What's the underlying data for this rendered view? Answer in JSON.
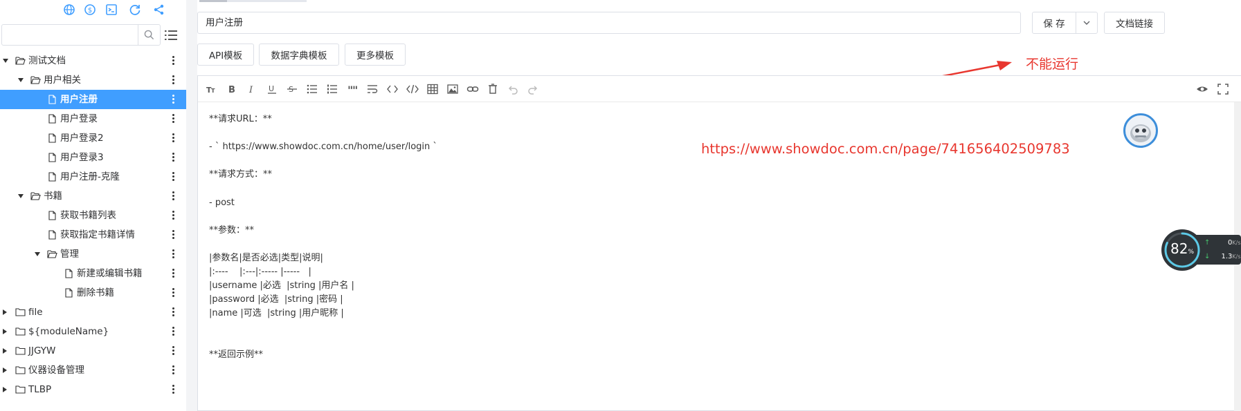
{
  "sidebar": {
    "search": {
      "value": "",
      "placeholder": ""
    },
    "top_icons": [
      "globe-icon",
      "dollar-icon",
      "terminal-icon",
      "refresh-icon",
      "share-icon"
    ],
    "tree": [
      {
        "label": "测试文档",
        "type": "folder",
        "expanded": true,
        "level": 0
      },
      {
        "label": "用户相关",
        "type": "folder",
        "expanded": true,
        "level": 1
      },
      {
        "label": "用户注册",
        "type": "file",
        "level": 2,
        "selected": true
      },
      {
        "label": "用户登录",
        "type": "file",
        "level": 2
      },
      {
        "label": "用户登录2",
        "type": "file",
        "level": 2
      },
      {
        "label": "用户登录3",
        "type": "file",
        "level": 2
      },
      {
        "label": "用户注册-克隆",
        "type": "file",
        "level": 2
      },
      {
        "label": "书籍",
        "type": "folder",
        "expanded": true,
        "level": 1
      },
      {
        "label": "获取书籍列表",
        "type": "file",
        "level": 2
      },
      {
        "label": "获取指定书籍详情",
        "type": "file",
        "level": 2
      },
      {
        "label": "管理",
        "type": "folder",
        "expanded": true,
        "level": 2
      },
      {
        "label": "新建或编辑书籍",
        "type": "file",
        "level": 3
      },
      {
        "label": "删除书籍",
        "type": "file",
        "level": 3
      },
      {
        "label": "file",
        "type": "folder",
        "expanded": false,
        "level": 0
      },
      {
        "label": "${moduleName}",
        "type": "folder",
        "expanded": false,
        "level": 0
      },
      {
        "label": "JJGYW",
        "type": "folder",
        "expanded": false,
        "level": 0
      },
      {
        "label": "仪器设备管理",
        "type": "folder",
        "expanded": false,
        "level": 0
      },
      {
        "label": "TLBP",
        "type": "folder",
        "expanded": false,
        "level": 0
      }
    ]
  },
  "header": {
    "title_value": "用户注册",
    "save_label": "保 存",
    "doc_link_label": "文档链接",
    "templates": [
      "API模板",
      "数据字典模板",
      "更多模板"
    ]
  },
  "annotation": {
    "text": "不能运行",
    "color": "#e8372f"
  },
  "url_overlay": "https://www.showdoc.com.cn/page/741656402509783",
  "editor": {
    "lines": [
      "**请求URL：**",
      "- ` https://www.showdoc.com.cn/home/user/login `",
      "**请求方式：**",
      "- post",
      "**参数：**",
      "|参数名|是否必选|类型|说明|",
      "|:----    |:---|:----- |-----   |",
      "|username |必选  |string |用户名 |",
      "|password |必选  |string |密码 |",
      "|name |可选  |string |用户昵称 |",
      "**返回示例**"
    ]
  },
  "net_speed": {
    "percent": "82",
    "percent_unit": "%",
    "up": "0",
    "down": "1.3",
    "unit": "K/s"
  },
  "colors": {
    "accent": "#409eff",
    "annotation_red": "#e8372f"
  }
}
